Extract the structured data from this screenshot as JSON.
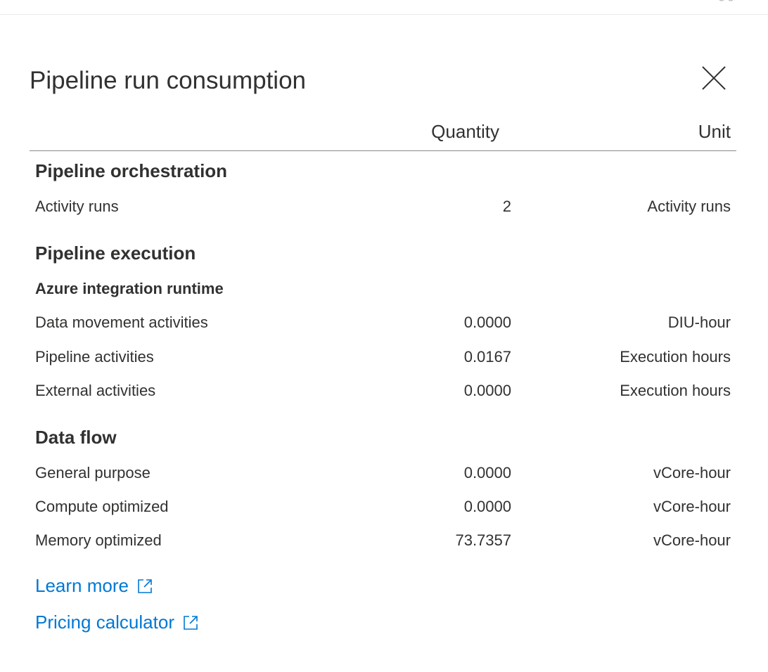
{
  "dialog": {
    "title": "Pipeline run consumption",
    "close_icon": "close-icon"
  },
  "table": {
    "headers": {
      "quantity": "Quantity",
      "unit": "Unit"
    }
  },
  "sections": {
    "orchestration": {
      "title": "Pipeline orchestration",
      "rows": [
        {
          "label": "Activity runs",
          "quantity": "2",
          "unit": "Activity runs"
        }
      ]
    },
    "execution": {
      "title": "Pipeline execution",
      "subtitle": "Azure integration runtime",
      "rows": [
        {
          "label": "Data movement activities",
          "quantity": "0.0000",
          "unit": "DIU-hour"
        },
        {
          "label": "Pipeline activities",
          "quantity": "0.0167",
          "unit": "Execution hours"
        },
        {
          "label": "External activities",
          "quantity": "0.0000",
          "unit": "Execution hours"
        }
      ]
    },
    "dataflow": {
      "title": "Data flow",
      "rows": [
        {
          "label": "General purpose",
          "quantity": "0.0000",
          "unit": "vCore-hour"
        },
        {
          "label": "Compute optimized",
          "quantity": "0.0000",
          "unit": "vCore-hour"
        },
        {
          "label": "Memory optimized",
          "quantity": "73.7357",
          "unit": "vCore-hour"
        }
      ]
    }
  },
  "links": {
    "learn_more": "Learn more",
    "pricing_calculator": "Pricing calculator",
    "icon": "external-link-icon"
  },
  "colors": {
    "text": "#323130",
    "link": "#0078d4",
    "divider": "#8a8886"
  }
}
